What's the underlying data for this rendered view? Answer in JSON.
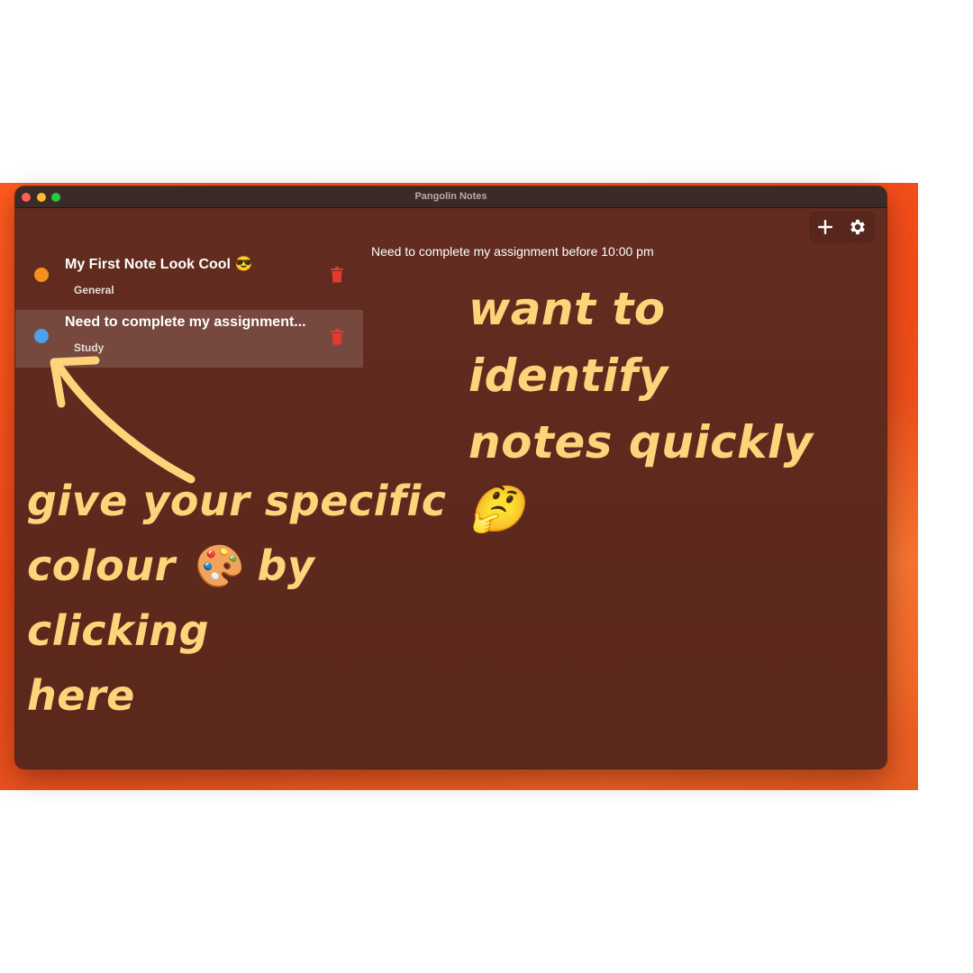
{
  "window": {
    "title": "Pangolin Notes"
  },
  "toolbar": {
    "add_icon": "plus-icon",
    "settings_icon": "gear-icon"
  },
  "notes": [
    {
      "title": "My First Note Look Cool 😎",
      "tag": "General",
      "color": "#f5901e"
    },
    {
      "title": "Need to complete my assignment...",
      "tag": "Study",
      "color": "#4aa3e8"
    }
  ],
  "detail": {
    "text": "Need to complete my assignment before 10:00 pm"
  },
  "annotations": {
    "top_line1": "want to identify",
    "top_line2": "notes quickly 🤔",
    "bottom_line1": "give your specific",
    "bottom_line2": "colour 🎨 by clicking",
    "bottom_line3": "here"
  },
  "colors": {
    "wallpaper": "#f04a18",
    "window_bg": "#5d291d",
    "annotation": "#ffd37a",
    "trash": "#e53b2f"
  }
}
